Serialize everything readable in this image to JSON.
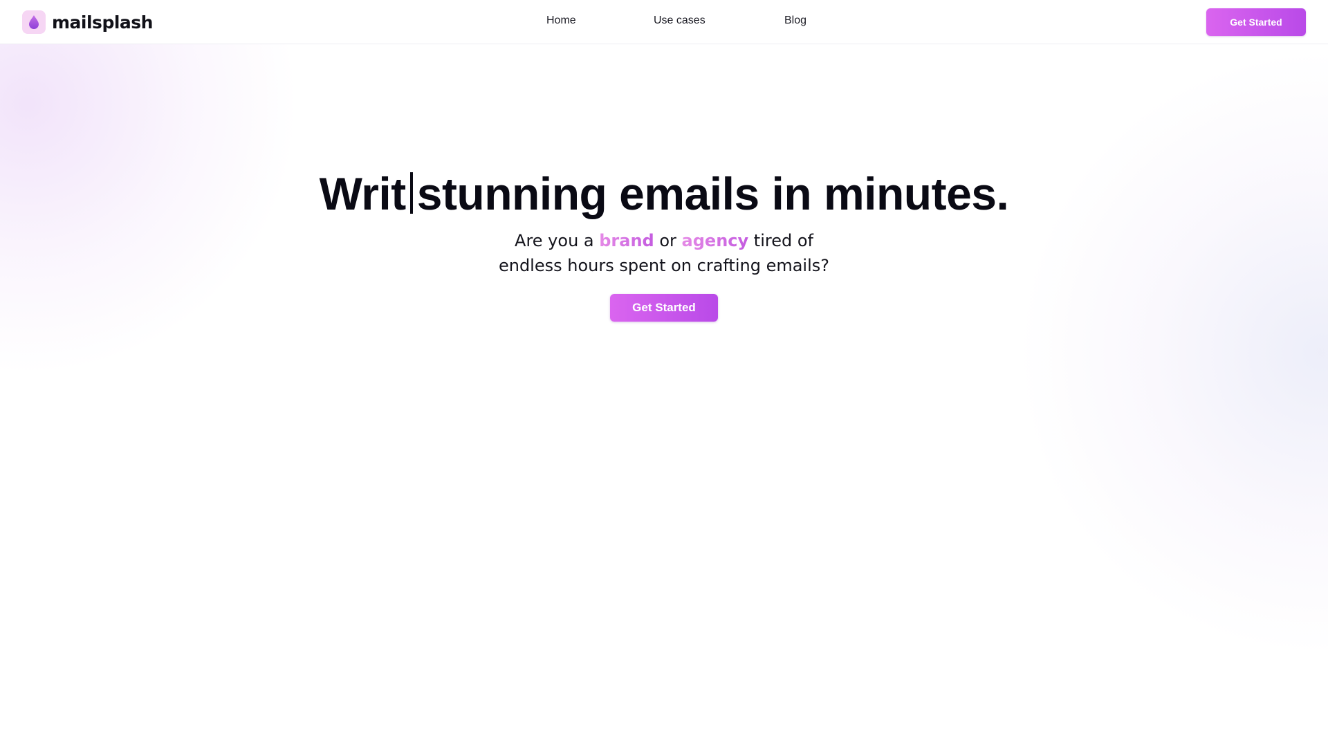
{
  "brand": {
    "name": "mailsplash",
    "icon": "droplet-icon",
    "accent_color": "#c65ce6",
    "logo_bg_color": "#f6d6f4"
  },
  "nav": {
    "items": [
      {
        "label": "Home"
      },
      {
        "label": "Use cases"
      },
      {
        "label": "Blog"
      }
    ]
  },
  "header": {
    "cta_label": "Get Started"
  },
  "hero": {
    "title_typed": "Writ",
    "title_rest": "stunning emails in minutes.",
    "subtitle_part1": "Are you a ",
    "subtitle_highlight1": "brand",
    "subtitle_part2": " or ",
    "subtitle_highlight2": "agency",
    "subtitle_part3": " tired of",
    "subtitle_line2": "endless hours spent on crafting emails?",
    "cta_label": "Get Started"
  }
}
